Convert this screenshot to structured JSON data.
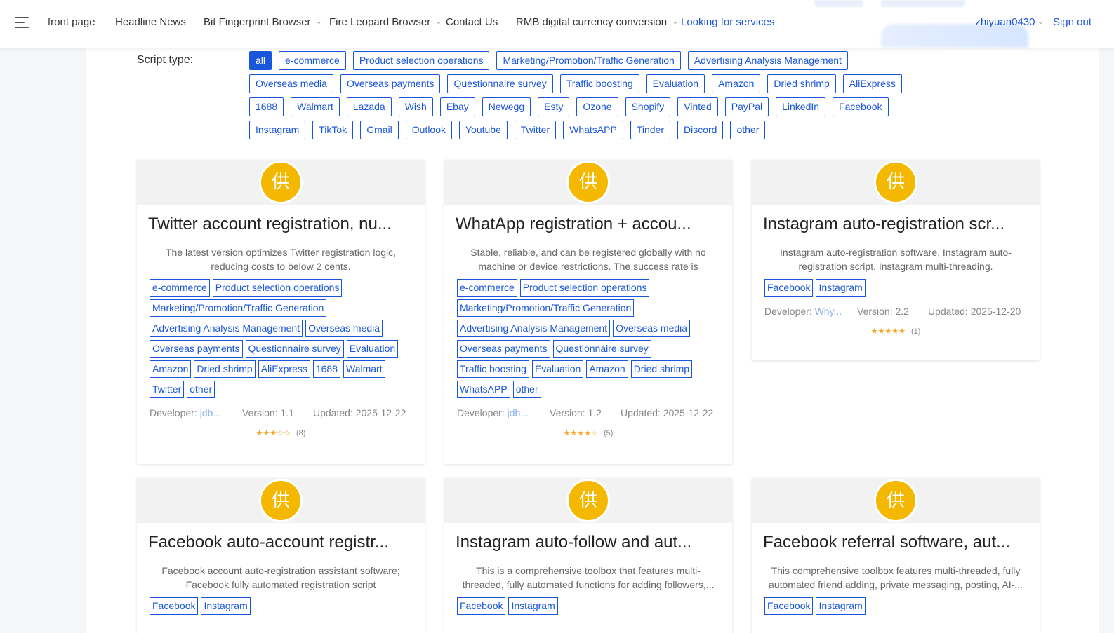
{
  "nav": {
    "items": [
      {
        "label": "front page",
        "dropdown": false
      },
      {
        "label": "Headline News",
        "dropdown": false
      },
      {
        "label": "Bit Fingerprint Browser",
        "dropdown": true
      },
      {
        "label": "Fire Leopard Browser",
        "dropdown": true
      },
      {
        "label": "Contact Us",
        "dropdown": false
      },
      {
        "label": "RMB digital currency conversion",
        "dropdown": true
      },
      {
        "label": "Looking for services",
        "dropdown": false,
        "active": true
      }
    ],
    "user": "zhiyuan0430",
    "signout": "Sign out"
  },
  "filters": {
    "label": "Script type:",
    "active": "all",
    "rows": [
      [
        "all",
        "e-commerce",
        "Product selection operations",
        "Marketing/Promotion/Traffic Generation",
        "Advertising Analysis Management"
      ],
      [
        "Overseas media",
        "Overseas payments",
        "Questionnaire survey",
        "Traffic boosting",
        "Evaluation",
        "Amazon",
        "Dried shrimp",
        "AliExpress"
      ],
      [
        "1688",
        "Walmart",
        "Lazada",
        "Wish",
        "Ebay",
        "Newegg",
        "Esty",
        "Ozone",
        "Shopify",
        "Vinted",
        "PayPal",
        "LinkedIn",
        "Facebook"
      ],
      [
        "Instagram",
        "TikTok",
        "Gmail",
        "Outlook",
        "Youtube",
        "Twitter",
        "WhatsAPP",
        "Tinder",
        "Discord",
        "other"
      ]
    ]
  },
  "labels": {
    "badge_char": "供",
    "developer": "Developer:",
    "version": "Version:",
    "updated": "Updated:"
  },
  "cards": [
    {
      "title": "Twitter account registration, nu...",
      "desc": "The latest version optimizes Twitter registration logic, reducing costs to below 2 cents.",
      "tags": [
        "e-commerce",
        "Product selection operations",
        "Marketing/Promotion/Traffic Generation",
        "Advertising Analysis Management",
        "Overseas media",
        "Overseas payments",
        "Questionnaire survey",
        "Evaluation",
        "Amazon",
        "Dried shrimp",
        "AliExpress",
        "1688",
        "Walmart",
        "Twitter",
        "other"
      ],
      "developer": "jdb...",
      "version": "1.1",
      "updated": "2025-12-22",
      "rating": 3,
      "reviews": "(8)"
    },
    {
      "title": "WhatApp registration + accou...",
      "desc": "Stable, reliable, and can be registered globally with no machine or device restrictions. The success rate is around...",
      "tags": [
        "e-commerce",
        "Product selection operations",
        "Marketing/Promotion/Traffic Generation",
        "Advertising Analysis Management",
        "Overseas media",
        "Overseas payments",
        "Questionnaire survey",
        "Traffic boosting",
        "Evaluation",
        "Amazon",
        "Dried shrimp",
        "WhatsAPP",
        "other"
      ],
      "developer": "jdb...",
      "version": "1.2",
      "updated": "2025-12-22",
      "rating": 4,
      "reviews": "(5)"
    },
    {
      "title": "Instagram auto-registration scr...",
      "desc": "Instagram auto-registration software, Instagram auto-registration script, Instagram multi-threading.",
      "tags": [
        "Facebook",
        "Instagram"
      ],
      "developer": "Why...",
      "version": "2.2",
      "updated": "2025-12-20",
      "rating": 5,
      "reviews": "(1)"
    },
    {
      "title": "Facebook auto-account registr...",
      "desc": "Facebook account auto-registration assistant software; Facebook fully automated registration script",
      "tags": [
        "Facebook",
        "Instagram"
      ]
    },
    {
      "title": "Instagram auto-follow and aut...",
      "desc": "This is a comprehensive toolbox that features multi-threaded, fully automated functions for adding followers,...",
      "tags": [
        "Facebook",
        "Instagram"
      ]
    },
    {
      "title": "Facebook referral software, aut...",
      "desc": "This comprehensive toolbox features multi-threaded, fully automated friend adding, private messaging, posting, AI-...",
      "tags": [
        "Facebook",
        "Instagram"
      ]
    }
  ],
  "colors": {
    "accent": "#1a56db",
    "badge": "#f5b800",
    "star": "#f5a623"
  }
}
